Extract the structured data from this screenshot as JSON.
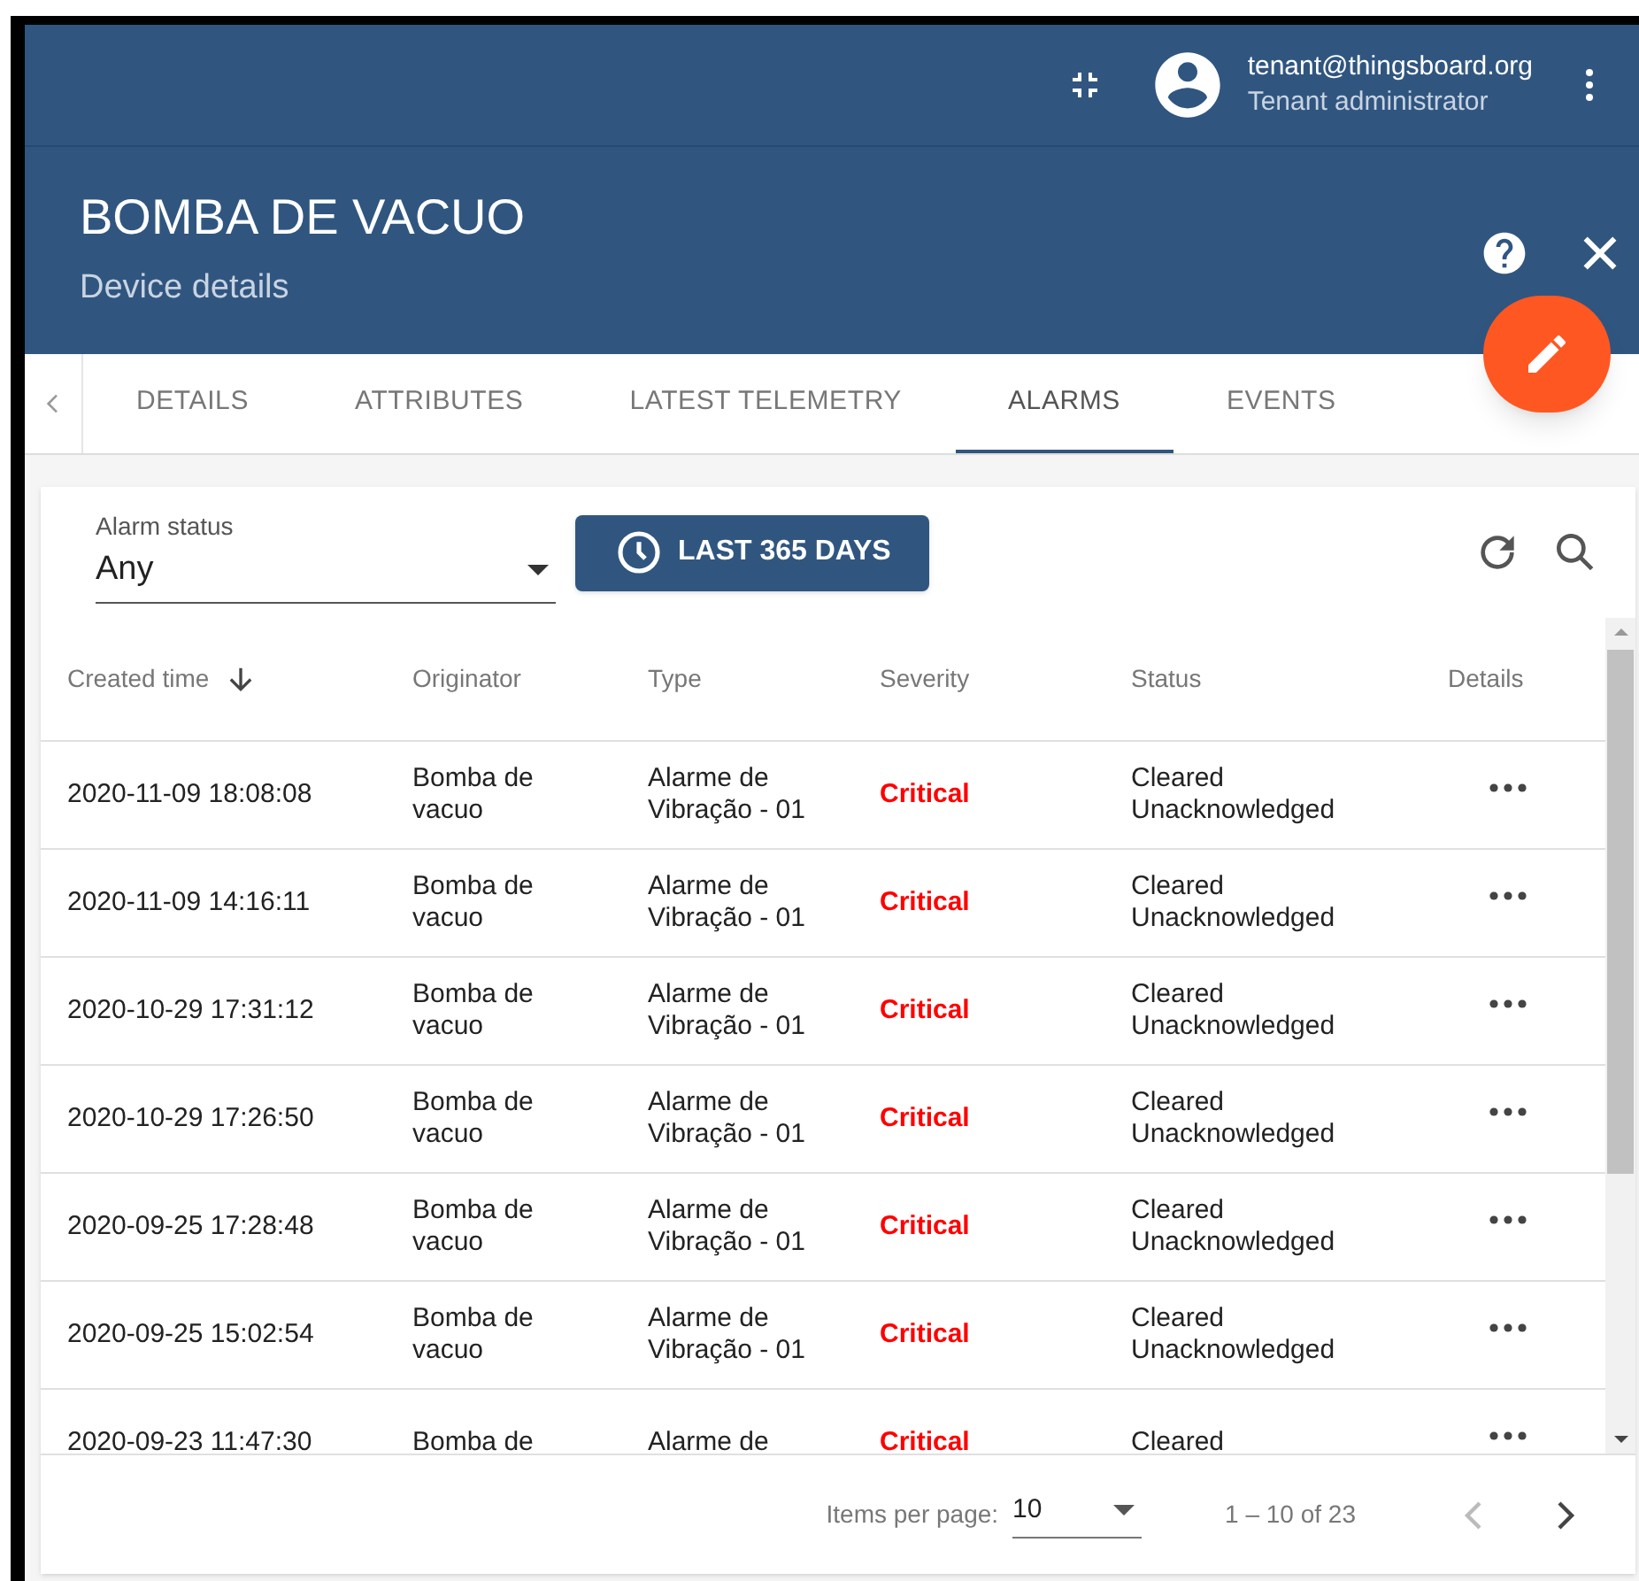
{
  "user": {
    "email": "tenant@thingsboard.org",
    "role": "Tenant administrator"
  },
  "header": {
    "title": "BOMBA DE VACUO",
    "subtitle": "Device details"
  },
  "tabs": [
    {
      "label": "DETAILS",
      "selected": false
    },
    {
      "label": "ATTRIBUTES",
      "selected": false
    },
    {
      "label": "LATEST TELEMETRY",
      "selected": false
    },
    {
      "label": "ALARMS",
      "selected": true
    },
    {
      "label": "EVENTS",
      "selected": false
    }
  ],
  "filter": {
    "label": "Alarm status",
    "value": "Any"
  },
  "time_button": "LAST 365 DAYS",
  "table": {
    "columns": [
      "Created time",
      "Originator",
      "Type",
      "Severity",
      "Status",
      "Details"
    ],
    "rows": [
      {
        "created": "2020-11-09 18:08:08",
        "originator": "Bomba de vacuo",
        "type": "Alarme de Vibração - 01",
        "severity": "Critical",
        "status": "Cleared Unacknowledged"
      },
      {
        "created": "2020-11-09 14:16:11",
        "originator": "Bomba de vacuo",
        "type": "Alarme de Vibração - 01",
        "severity": "Critical",
        "status": "Cleared Unacknowledged"
      },
      {
        "created": "2020-10-29 17:31:12",
        "originator": "Bomba de vacuo",
        "type": "Alarme de Vibração - 01",
        "severity": "Critical",
        "status": "Cleared Unacknowledged"
      },
      {
        "created": "2020-10-29 17:26:50",
        "originator": "Bomba de vacuo",
        "type": "Alarme de Vibração - 01",
        "severity": "Critical",
        "status": "Cleared Unacknowledged"
      },
      {
        "created": "2020-09-25 17:28:48",
        "originator": "Bomba de vacuo",
        "type": "Alarme de Vibração - 01",
        "severity": "Critical",
        "status": "Cleared Unacknowledged"
      },
      {
        "created": "2020-09-25 15:02:54",
        "originator": "Bomba de vacuo",
        "type": "Alarme de Vibração - 01",
        "severity": "Critical",
        "status": "Cleared Unacknowledged"
      },
      {
        "created": "2020-09-23 11:47:30",
        "originator": "Bomba de",
        "type": "Alarme de",
        "severity": "Critical",
        "status": "Cleared"
      }
    ]
  },
  "pagination": {
    "label": "Items per page:",
    "page_size": "10",
    "range": "1 – 10 of 23"
  }
}
